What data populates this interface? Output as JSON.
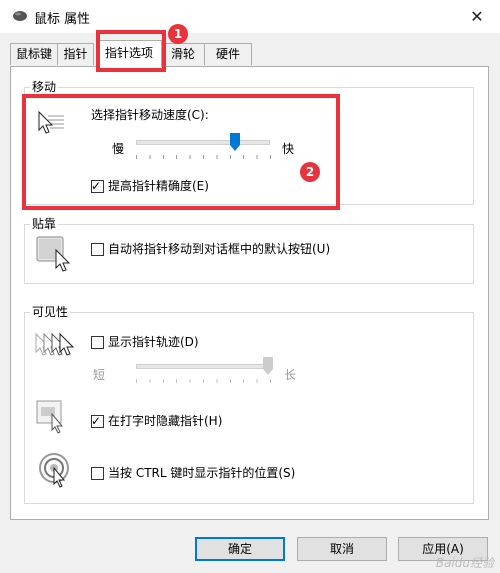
{
  "window": {
    "title": "鼠标 属性",
    "close_glyph": "✕"
  },
  "tabs": [
    {
      "label": "鼠标键"
    },
    {
      "label": "指针"
    },
    {
      "label": "指针选项"
    },
    {
      "label": "滑轮"
    },
    {
      "label": "硬件"
    }
  ],
  "motion": {
    "legend": "移动",
    "speed_label": "选择指针移动速度(C):",
    "slow": "慢",
    "fast": "快",
    "speed_level": 0.75,
    "precision_label": "提高指针精确度(E)",
    "precision_checked": true
  },
  "snap": {
    "legend": "贴靠",
    "label": "自动将指针移动到对话框中的默认按钮(U)",
    "checked": false
  },
  "visibility": {
    "legend": "可见性",
    "trails_label": "显示指针轨迹(D)",
    "trails_checked": false,
    "short": "短",
    "long": "长",
    "trail_level": 1.0,
    "hide_label": "在打字时隐藏指针(H)",
    "hide_checked": true,
    "ctrl_label": "当按 CTRL 键时显示指针的位置(S)",
    "ctrl_checked": false
  },
  "buttons": {
    "ok": "确定",
    "cancel": "取消",
    "apply": "应用(A)"
  },
  "annotations": {
    "badge1": "1",
    "badge2": "2",
    "color": "#e8323c"
  },
  "watermark": "Baidu经验"
}
